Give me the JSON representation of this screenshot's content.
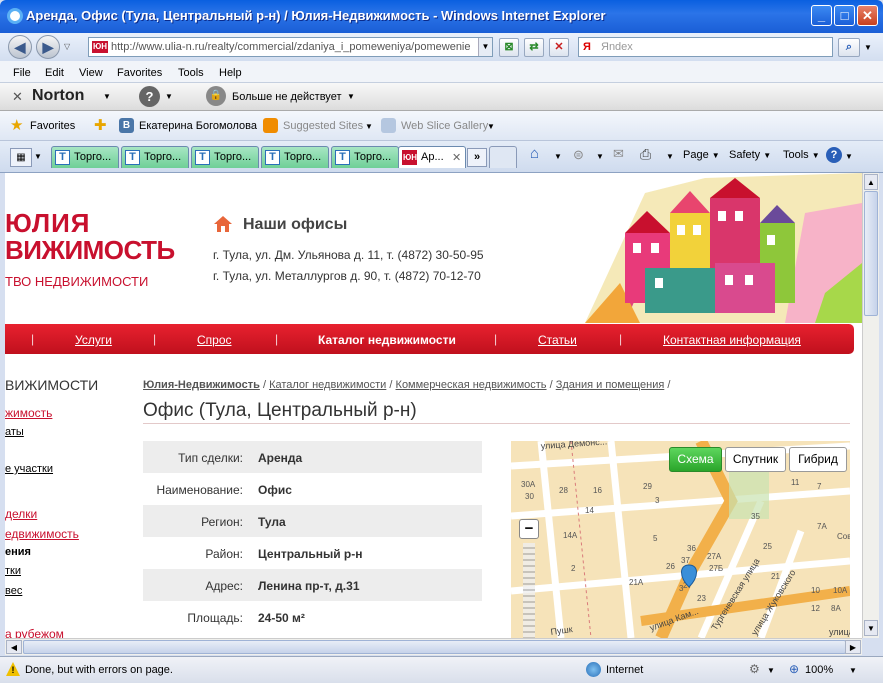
{
  "window": {
    "title": "Аренда, Офис (Тула, Центральный р-н) / Юлия-Недвижимость - Windows Internet Explorer",
    "minimize": "_",
    "maximize": "□",
    "close": "✕"
  },
  "address_bar": {
    "url": "http://www.ulia-n.ru/realty/commercial/zdaniya_i_pomeweniya/pomewenie",
    "favicon_text": "ЮН",
    "search_engine": "Я",
    "search_placeholder": "Яndex"
  },
  "menu": [
    "File",
    "Edit",
    "View",
    "Favorites",
    "Tools",
    "Help"
  ],
  "norton": {
    "logo": "Norton",
    "help": "?",
    "status": "Больше не действует"
  },
  "favorites_bar": {
    "favorites": "Favorites",
    "vk_label": "Екатерина Богомолова",
    "vk_icon": "В",
    "suggested": "Suggested Sites",
    "webslice": "Web Slice Gallery"
  },
  "tabs": [
    {
      "label": "Торго...",
      "icon": "T"
    },
    {
      "label": "Торго...",
      "icon": "T"
    },
    {
      "label": "Торго...",
      "icon": "T"
    },
    {
      "label": "Торго...",
      "icon": "T"
    },
    {
      "label": "Торго...",
      "icon": "T"
    },
    {
      "label": "Ар...",
      "icon": "ЮН",
      "close": "✕",
      "active": true
    }
  ],
  "command_bar": {
    "page": "Page",
    "safety": "Safety",
    "tools": "Tools",
    "help": "?",
    "more_tabs": "»"
  },
  "site": {
    "logo_line1": "ЮЛИЯ",
    "logo_line2": "ВИЖИМОСТЬ",
    "logo_line3": "ТВО НЕДВИЖИМОСТИ",
    "offices_title": "Наши офисы",
    "address1": "г. Тула, ул. Дм. Ульянова д. 11, т. (4872) 30-50-95",
    "address2": "г. Тула, ул. Металлургов д. 90, т. (4872) 70-12-70",
    "nav": {
      "services": "Услуги",
      "demand": "Спрос",
      "catalog": "Каталог недвижимости",
      "articles": "Статьи",
      "contacts": "Контактная информация"
    },
    "sidebar": {
      "heading": "ВИЖИМОСТИ",
      "item1": "жимость",
      "item2": "аты",
      "item3": "е участки",
      "item4": "делки",
      "item5": "едвижимость",
      "item6": "ения",
      "item7": "тки",
      "item8": "вес",
      "item9": "а рубежом"
    },
    "breadcrumb": {
      "c1": "Юлия-Недвижимость",
      "c2": "Каталог недвижимости",
      "c3": "Коммерческая недвижимость",
      "c4": "Здания и помещения",
      "sep": "/"
    },
    "page_title": "Офис (Тула, Центральный р-н)",
    "properties": [
      {
        "key": "Тип сделки:",
        "value": "Аренда"
      },
      {
        "key": "Наименование:",
        "value": "Офис"
      },
      {
        "key": "Регион:",
        "value": "Тула"
      },
      {
        "key": "Район:",
        "value": "Центральный р-н"
      },
      {
        "key": "Адрес:",
        "value": "Ленина пр-т, д.31"
      },
      {
        "key": "Площадь:",
        "value": "24-50 м²"
      }
    ],
    "map": {
      "scheme": "Схема",
      "satellite": "Спутник",
      "hybrid": "Гибрид",
      "zoom_out": "−",
      "streets": {
        "s1": "улица Демонс...",
        "s2": "Тургеневская улица",
        "s3": "улица Жуковского",
        "s4": "улица Кам...",
        "s5": "Пушк",
        "s6": "улица"
      },
      "labels": [
        "30А",
        "30",
        "28",
        "16",
        "14",
        "14А",
        "29",
        "3",
        "5",
        "26",
        "27",
        "23",
        "27А",
        "27Б",
        "25",
        "21",
        "11",
        "7",
        "7А",
        "10",
        "12",
        "10А",
        "8А",
        "Сов",
        "2",
        "21А",
        "35",
        "36",
        "37",
        "3"
      ]
    }
  },
  "status": {
    "text": "Done, but with errors on page.",
    "zone": "Internet",
    "zoom": "100%"
  }
}
